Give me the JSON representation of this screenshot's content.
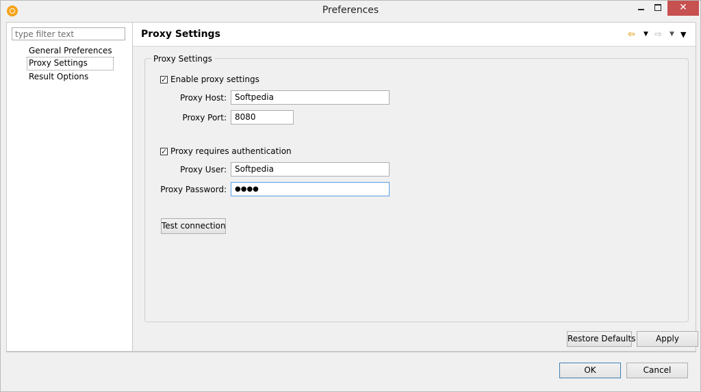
{
  "window": {
    "title": "Preferences",
    "min_label": "",
    "max_label": "",
    "close_label": "✕"
  },
  "left": {
    "filter_placeholder": "type filter text",
    "items": [
      {
        "label": "General Preferences"
      },
      {
        "label": "Proxy Settings",
        "selected": true
      },
      {
        "label": "Result Options"
      }
    ]
  },
  "page": {
    "title": "Proxy Settings",
    "nav_back": "⇦",
    "nav_back_dropdown": "▼",
    "nav_forward": "⇨",
    "nav_forward_dropdown": "▼",
    "view_menu": "▼"
  },
  "proxy": {
    "group_label": "Proxy Settings",
    "enable_label": "Enable proxy settings",
    "enable_checked": "✓",
    "host_label": "Proxy Host:",
    "host_value": "Softpedia",
    "port_label": "Proxy Port:",
    "port_value": "8080",
    "auth_label": "Proxy requires authentication",
    "auth_checked": "✓",
    "user_label": "Proxy User:",
    "user_value": "Softpedia",
    "password_label": "Proxy Password:",
    "password_value": "●●●●",
    "test_button": "Test connection"
  },
  "buttons": {
    "restore_defaults": "Restore Defaults",
    "apply": "Apply",
    "ok": "OK",
    "cancel": "Cancel"
  },
  "colors": {
    "close_button": "#c75050",
    "app_icon": "#f6a21a",
    "back_arrow": "#e2a21b",
    "focus_border": "#569de5"
  }
}
